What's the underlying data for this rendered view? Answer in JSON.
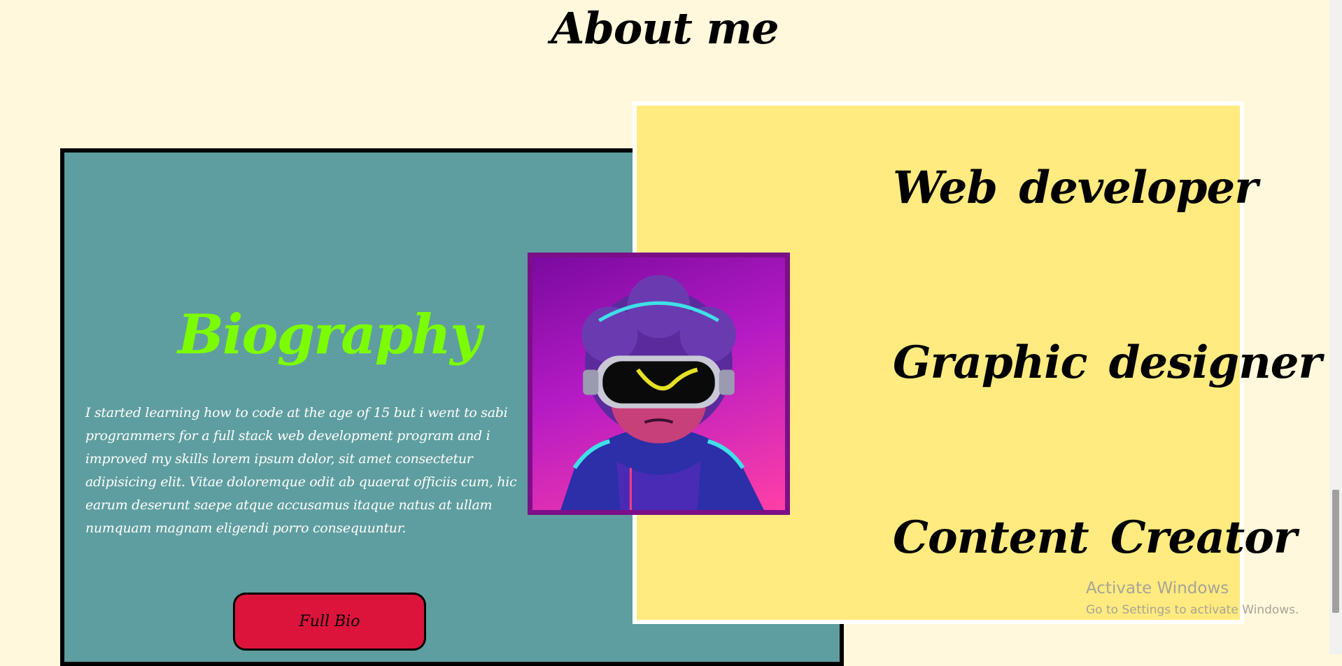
{
  "about": {
    "title": "About me"
  },
  "biography": {
    "heading": "Biography",
    "text": "I started learning how to code at the age of 15 but i went to sabi programmers for a full stack web development program and i improved my skills lorem ipsum dolor, sit amet consectetur adipisicing elit. Vitae doloremque odit ab quaerat officiis cum, hic earum deserunt saepe atque accusamus itaque natus at ullam numquam magnam eligendi porro consequuntur.",
    "button_label": "Full Bio"
  },
  "roles": [
    {
      "label": "Web developer"
    },
    {
      "label": "Graphic designer"
    },
    {
      "label": "Content Creator"
    }
  ],
  "avatar": {
    "icon": "vr-headset-character-avatar"
  },
  "watermark": {
    "title": "Activate Windows",
    "subtitle": "Go to Settings to activate Windows."
  },
  "colors": {
    "page_background": "#fff8dc",
    "bio_card": "#5f9ea0",
    "bio_heading": "#7cfc00",
    "button": "#dc143c",
    "roles_card": "#ffeb80",
    "avatar_border": "#7b0f87"
  }
}
